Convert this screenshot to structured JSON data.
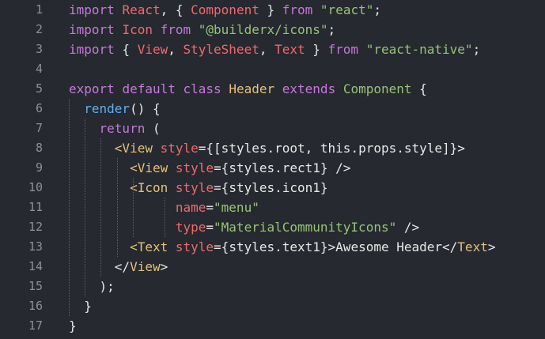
{
  "editor": {
    "language": "javascript",
    "theme_colors": {
      "background": "#26292f",
      "gutter_text": "#8d9096",
      "keyword": "#c678dd",
      "identifier": "#ef6a6f",
      "string": "#98c379",
      "class_or_tag": "#e5c07b",
      "function": "#61afef",
      "plain": "#e8e8e8"
    },
    "lines": [
      {
        "number": "1",
        "tokens": [
          {
            "t": "import",
            "k": "kw"
          },
          {
            "t": " ",
            "k": "pl"
          },
          {
            "t": "React",
            "k": "id"
          },
          {
            "t": ", { ",
            "k": "pl"
          },
          {
            "t": "Component",
            "k": "id"
          },
          {
            "t": " } ",
            "k": "pl"
          },
          {
            "t": "from",
            "k": "kw"
          },
          {
            "t": " ",
            "k": "pl"
          },
          {
            "t": "\"react\"",
            "k": "str"
          },
          {
            "t": ";",
            "k": "pl"
          }
        ]
      },
      {
        "number": "2",
        "tokens": [
          {
            "t": "import",
            "k": "kw"
          },
          {
            "t": " ",
            "k": "pl"
          },
          {
            "t": "Icon",
            "k": "id"
          },
          {
            "t": " ",
            "k": "pl"
          },
          {
            "t": "from",
            "k": "kw"
          },
          {
            "t": " ",
            "k": "pl"
          },
          {
            "t": "\"@builderx/icons\"",
            "k": "str"
          },
          {
            "t": ";",
            "k": "pl"
          }
        ]
      },
      {
        "number": "3",
        "tokens": [
          {
            "t": "import",
            "k": "kw"
          },
          {
            "t": " { ",
            "k": "pl"
          },
          {
            "t": "View",
            "k": "id"
          },
          {
            "t": ", ",
            "k": "pl"
          },
          {
            "t": "StyleSheet",
            "k": "id"
          },
          {
            "t": ", ",
            "k": "pl"
          },
          {
            "t": "Text",
            "k": "id"
          },
          {
            "t": " } ",
            "k": "pl"
          },
          {
            "t": "from",
            "k": "kw"
          },
          {
            "t": " ",
            "k": "pl"
          },
          {
            "t": "\"react-native\"",
            "k": "str"
          },
          {
            "t": ";",
            "k": "pl"
          }
        ]
      },
      {
        "number": "4",
        "tokens": []
      },
      {
        "number": "5",
        "tokens": [
          {
            "t": "export",
            "k": "kw"
          },
          {
            "t": " ",
            "k": "pl"
          },
          {
            "t": "default",
            "k": "kw"
          },
          {
            "t": " ",
            "k": "pl"
          },
          {
            "t": "class",
            "k": "kw"
          },
          {
            "t": " ",
            "k": "pl"
          },
          {
            "t": "Header",
            "k": "cls"
          },
          {
            "t": " ",
            "k": "pl"
          },
          {
            "t": "extends",
            "k": "kw"
          },
          {
            "t": " ",
            "k": "pl"
          },
          {
            "t": "Component",
            "k": "str"
          },
          {
            "t": " {",
            "k": "pl"
          }
        ]
      },
      {
        "number": "6",
        "tokens": [
          {
            "t": "  ",
            "k": "pl"
          },
          {
            "t": "render",
            "k": "fn"
          },
          {
            "t": "() {",
            "k": "pl"
          }
        ]
      },
      {
        "number": "7",
        "tokens": [
          {
            "t": "    ",
            "k": "pl"
          },
          {
            "t": "return",
            "k": "kw"
          },
          {
            "t": " (",
            "k": "pl"
          }
        ]
      },
      {
        "number": "8",
        "tokens": [
          {
            "t": "      ",
            "k": "pl"
          },
          {
            "t": "<View",
            "k": "tag"
          },
          {
            "t": " ",
            "k": "pl"
          },
          {
            "t": "style",
            "k": "attr"
          },
          {
            "t": "={[styles.root, this.props.style]}>",
            "k": "pl"
          }
        ]
      },
      {
        "number": "9",
        "tokens": [
          {
            "t": "        ",
            "k": "pl"
          },
          {
            "t": "<View",
            "k": "tag"
          },
          {
            "t": " ",
            "k": "pl"
          },
          {
            "t": "style",
            "k": "attr"
          },
          {
            "t": "={styles.rect1} />",
            "k": "pl"
          }
        ]
      },
      {
        "number": "10",
        "tokens": [
          {
            "t": "        ",
            "k": "pl"
          },
          {
            "t": "<Icon",
            "k": "tag"
          },
          {
            "t": " ",
            "k": "pl"
          },
          {
            "t": "style",
            "k": "attr"
          },
          {
            "t": "={styles.icon1}",
            "k": "pl"
          }
        ]
      },
      {
        "number": "11",
        "tokens": [
          {
            "t": "              ",
            "k": "pl"
          },
          {
            "t": "name",
            "k": "attr"
          },
          {
            "t": "=",
            "k": "pl"
          },
          {
            "t": "\"menu\"",
            "k": "str"
          }
        ]
      },
      {
        "number": "12",
        "tokens": [
          {
            "t": "              ",
            "k": "pl"
          },
          {
            "t": "type",
            "k": "attr"
          },
          {
            "t": "=",
            "k": "pl"
          },
          {
            "t": "\"MaterialCommunityIcons\"",
            "k": "str"
          },
          {
            "t": " />",
            "k": "pl"
          }
        ]
      },
      {
        "number": "13",
        "tokens": [
          {
            "t": "        ",
            "k": "pl"
          },
          {
            "t": "<Text",
            "k": "tag"
          },
          {
            "t": " ",
            "k": "pl"
          },
          {
            "t": "style",
            "k": "attr"
          },
          {
            "t": "={styles.text1}>Awesome Header</",
            "k": "pl"
          },
          {
            "t": "Text",
            "k": "tag"
          },
          {
            "t": ">",
            "k": "pl"
          }
        ]
      },
      {
        "number": "14",
        "tokens": [
          {
            "t": "      </",
            "k": "pl"
          },
          {
            "t": "View",
            "k": "tag"
          },
          {
            "t": ">",
            "k": "pl"
          }
        ]
      },
      {
        "number": "15",
        "tokens": [
          {
            "t": "    );",
            "k": "pl"
          }
        ]
      },
      {
        "number": "16",
        "tokens": [
          {
            "t": "  }",
            "k": "pl"
          }
        ]
      },
      {
        "number": "17",
        "tokens": [
          {
            "t": "}",
            "k": "pl"
          }
        ]
      }
    ]
  }
}
